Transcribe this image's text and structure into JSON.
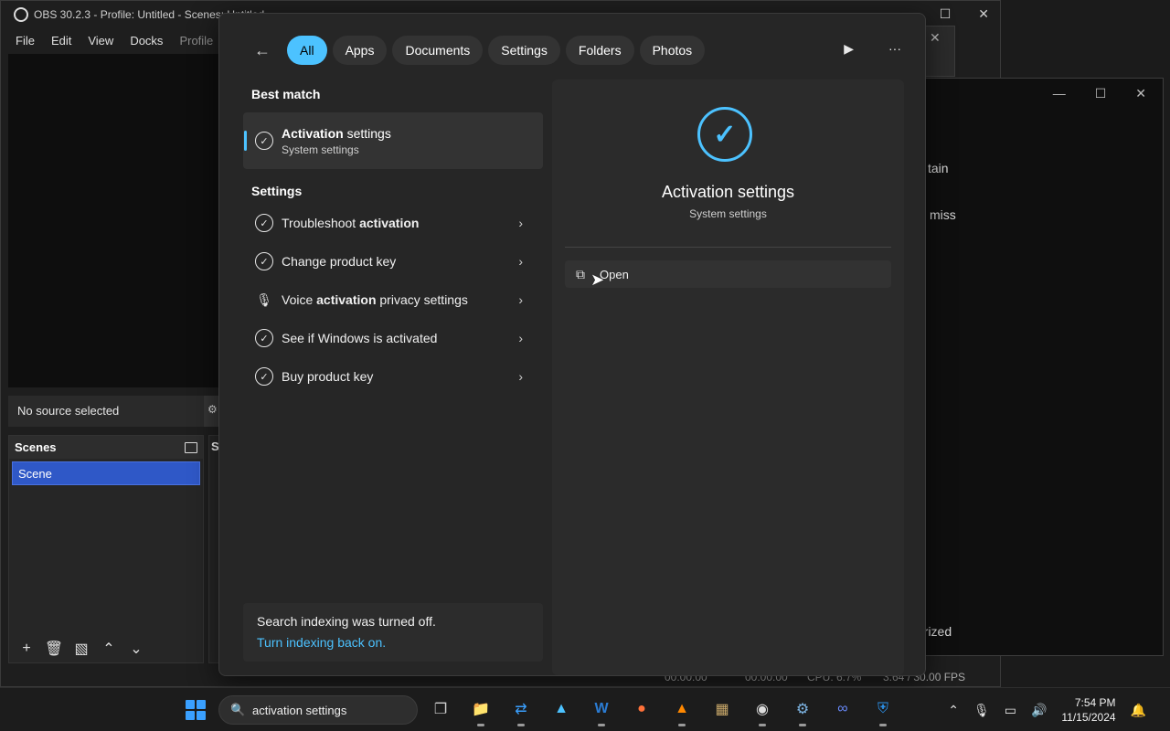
{
  "obs": {
    "title": "OBS 30.2.3 - Profile: Untitled - Scenes: Untitled",
    "menu": [
      "File",
      "Edit",
      "View",
      "Docks",
      "Profile"
    ],
    "no_source": "No source selected",
    "scenes_header": "Scenes",
    "scene_item": "Scene",
    "sources_header_fragment": "S",
    "status": {
      "rec_time_1": "00:00:00",
      "rec_time_2": "00:00:00",
      "cpu": "CPU: 6.7%",
      "fps": "3.64 / 30.00 FPS"
    }
  },
  "bgwin2": {
    "fragments": [
      "tain",
      "miss",
      "orized"
    ]
  },
  "search": {
    "filters": [
      "All",
      "Apps",
      "Documents",
      "Settings",
      "Folders",
      "Photos"
    ],
    "best_match_title": "Best match",
    "best_match": {
      "title_bold": "Activation",
      "title_rest": " settings",
      "subtitle": "System settings"
    },
    "settings_title": "Settings",
    "settings_results": [
      {
        "pre": "Troubleshoot ",
        "bold": "activation",
        "post": ""
      },
      {
        "pre": "Change product key",
        "bold": "",
        "post": ""
      },
      {
        "pre": "Voice ",
        "bold": "activation",
        "post": " privacy settings"
      },
      {
        "pre": "See if Windows is activated",
        "bold": "",
        "post": ""
      },
      {
        "pre": "Buy product key",
        "bold": "",
        "post": ""
      }
    ],
    "index_note": {
      "message": "Search indexing was turned off.",
      "link": "Turn indexing back on."
    },
    "detail": {
      "title": "Activation settings",
      "subtitle": "System settings",
      "open_label": "Open"
    }
  },
  "taskbar": {
    "search_text": "activation settings",
    "time": "7:54 PM",
    "date": "11/15/2024",
    "apps": [
      "task-view-icon",
      "file-explorer-icon",
      "remote-desktop-icon",
      "photos-icon",
      "word-icon",
      "firefox-icon",
      "vlc-icon",
      "archive-icon",
      "obs-icon",
      "control-panel-icon",
      "link-app-icon",
      "security-icon"
    ]
  },
  "colors": {
    "accent": "#4cc2ff",
    "scene_selected": "#2f58c7",
    "flyout_bg": "#262626"
  }
}
